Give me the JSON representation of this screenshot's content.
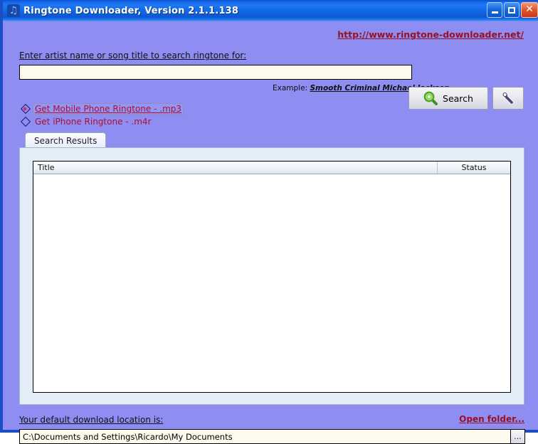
{
  "window": {
    "title": "Ringtone Downloader, Version 2.1.1.138",
    "icon": "music-note-icon",
    "controls": {
      "minimize": "Minimize",
      "maximize": "Maximize",
      "close": "Close",
      "close_glyph": "✕"
    },
    "colors": {
      "titlebar_blue": "#1268e4",
      "client_background": "#8d8df2",
      "link_red": "#9b1020",
      "radio_label_red": "#b01030",
      "input_cream": "#fdfbee",
      "panel_blue": "#e3edf7"
    }
  },
  "header": {
    "site_link": "http://www.ringtone-downloader.net/"
  },
  "search": {
    "label": "Enter artist name or song title to search ringtone for:",
    "value": "",
    "placeholder": "",
    "example_prefix": "Example:",
    "example_value": "Smooth Criminal Michael Jackson",
    "search_button": "Search",
    "search_icon": "magnifier-icon",
    "settings_icon": "wrench-icon"
  },
  "format_options": [
    {
      "label": "Get Mobile Phone Ringtone - .mp3",
      "selected": true,
      "focused": true
    },
    {
      "label": "Get iPhone Ringtone - .m4r",
      "selected": false,
      "focused": false
    }
  ],
  "tabs": [
    {
      "label": "Search Results",
      "active": true
    }
  ],
  "results": {
    "columns": [
      "Title",
      "Status"
    ],
    "rows": []
  },
  "footer": {
    "location_label": "Your default download location is:",
    "open_folder_link": "Open folder...",
    "path_value": "C:\\Documents and Settings\\Ricardo\\My Documents",
    "browse_button": "..."
  }
}
